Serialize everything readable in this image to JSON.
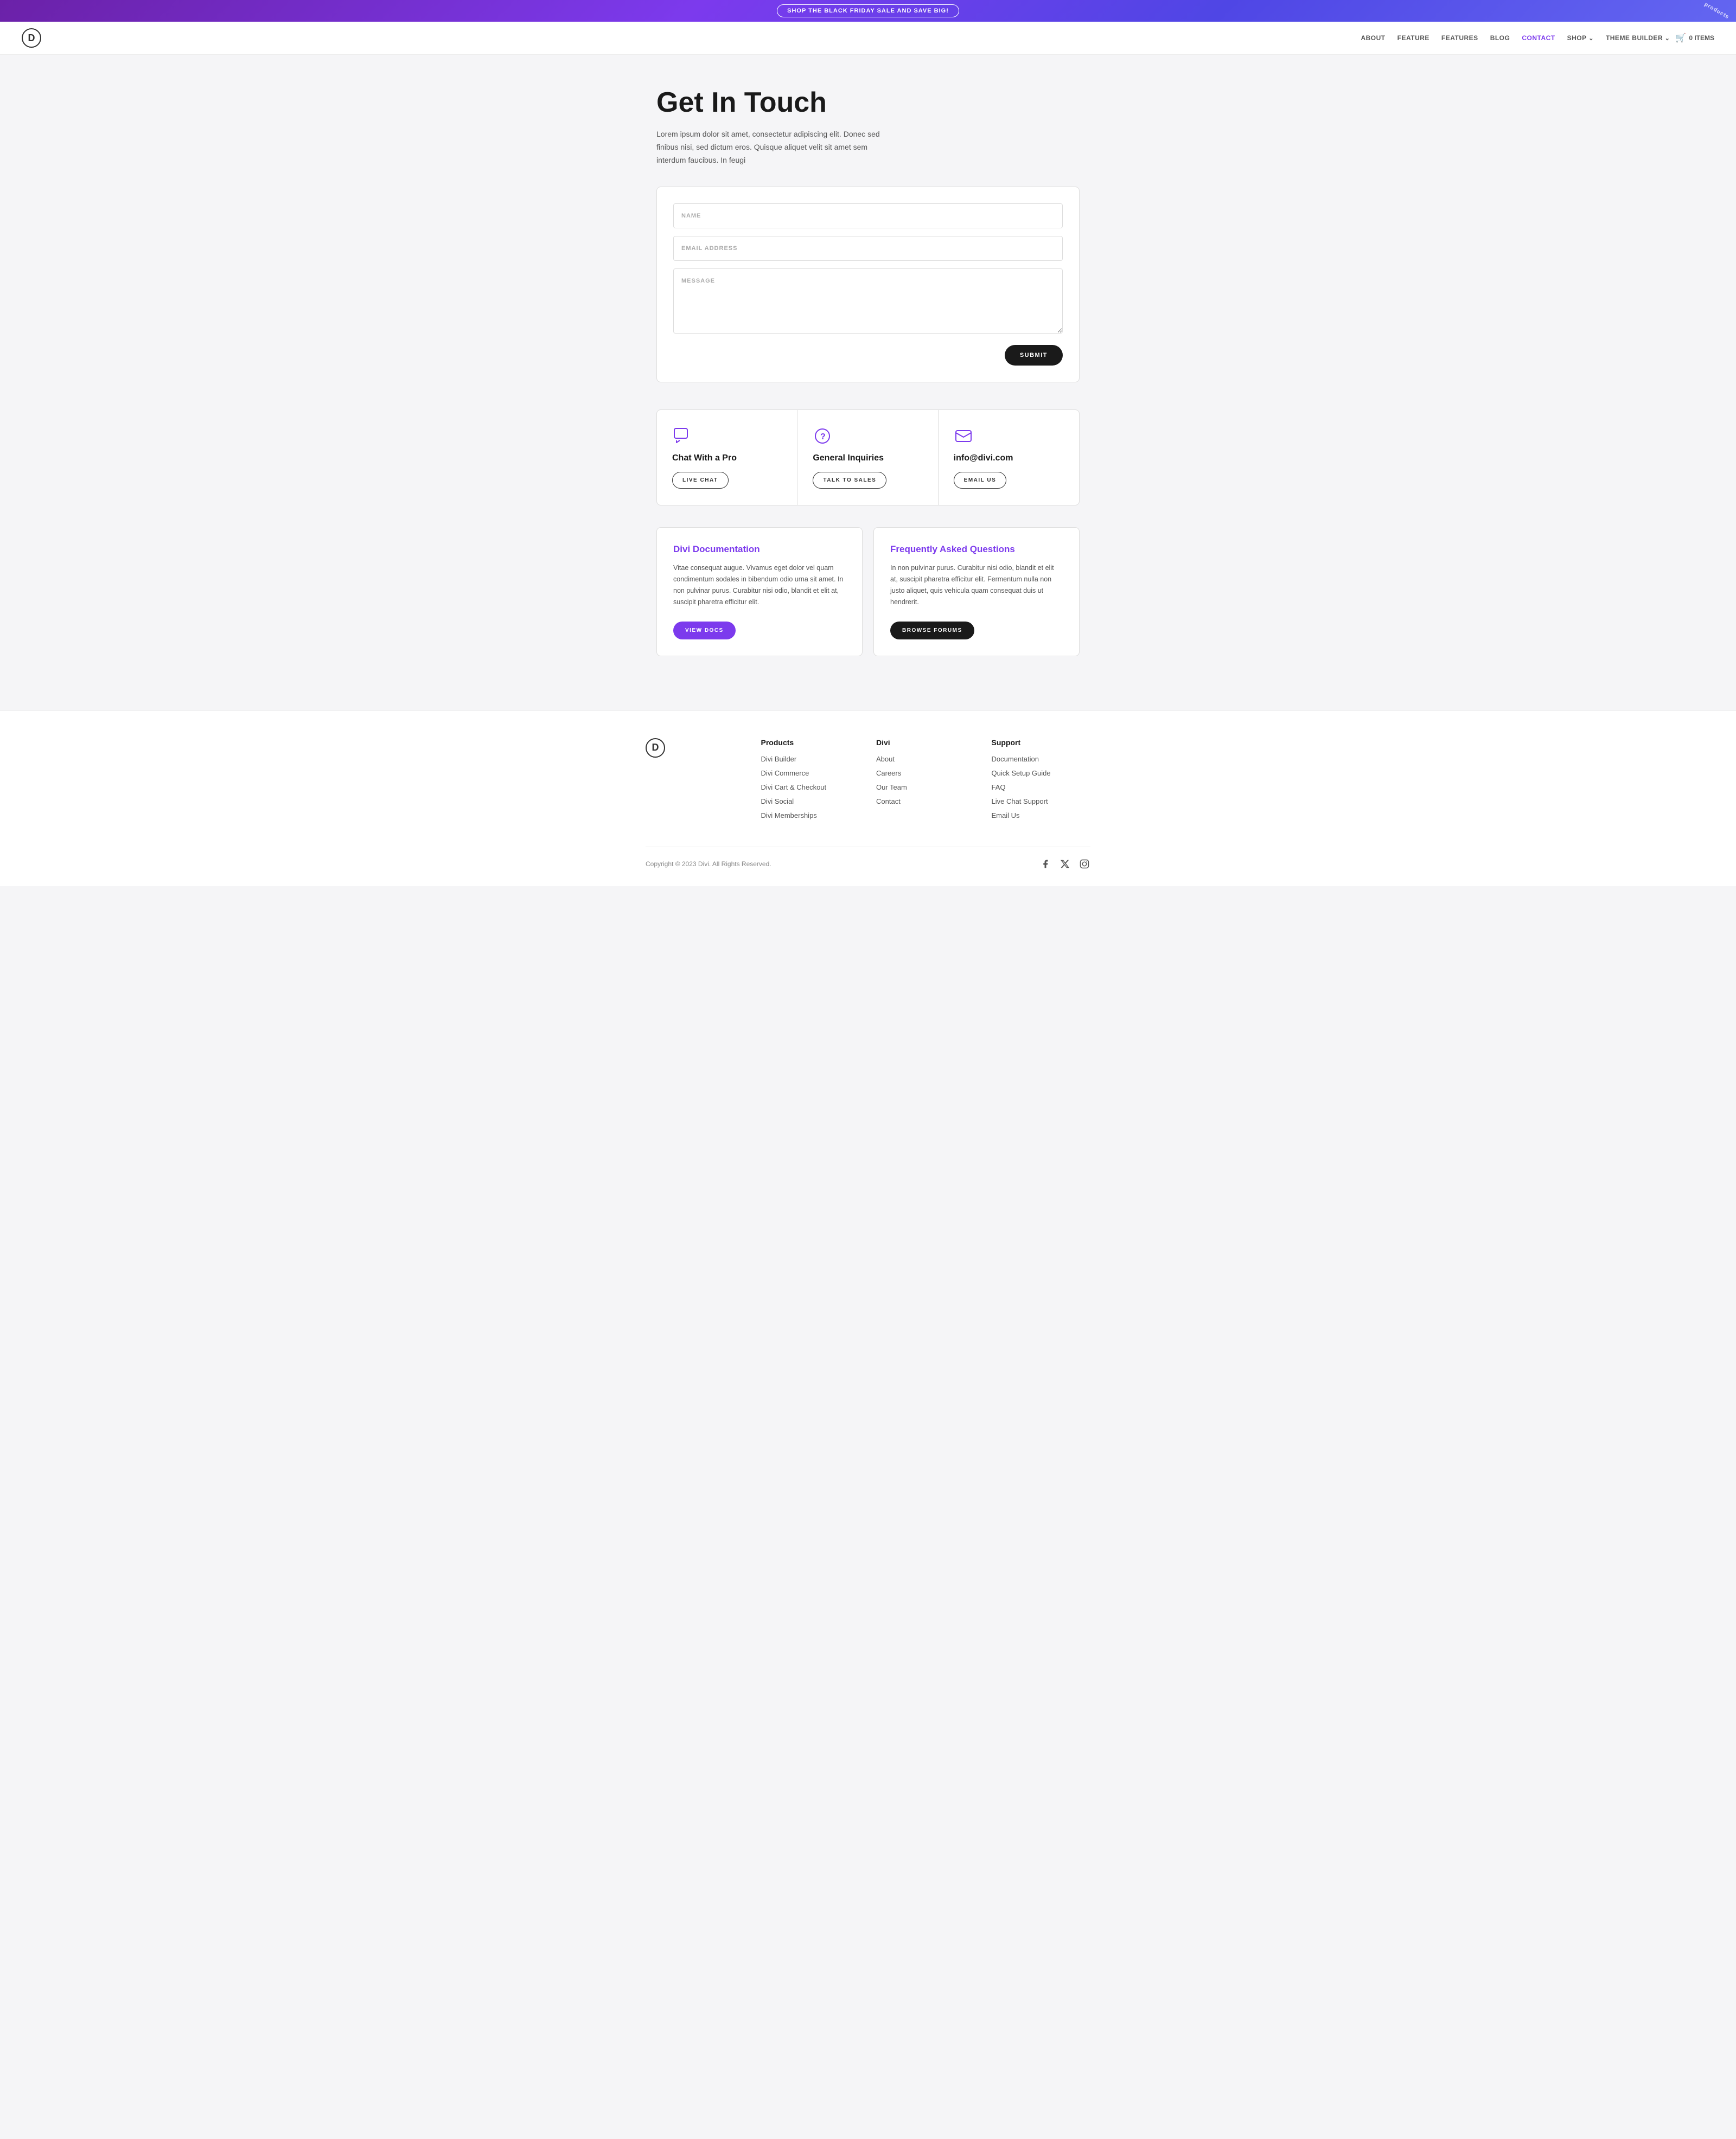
{
  "banner": {
    "cta_label": "SHOP THE BLACK FRIDAY SALE AND SAVE BIG!",
    "products_label": "products"
  },
  "nav": {
    "logo_letter": "D",
    "links": [
      {
        "label": "ABOUT",
        "active": false
      },
      {
        "label": "FEATURE",
        "active": false
      },
      {
        "label": "FEATURES",
        "active": false
      },
      {
        "label": "BLOG",
        "active": false
      },
      {
        "label": "CONTACT",
        "active": true
      },
      {
        "label": "SHOP",
        "active": false,
        "has_arrow": true
      },
      {
        "label": "THEME BUILDER",
        "active": false,
        "has_arrow": true
      }
    ],
    "cart_label": "0 ITEMS"
  },
  "hero": {
    "title": "Get In Touch",
    "description": "Lorem ipsum dolor sit amet, consectetur adipiscing elit. Donec sed finibus nisi, sed dictum eros. Quisque aliquet velit sit amet sem interdum faucibus. In feugi"
  },
  "form": {
    "name_placeholder": "NAME",
    "email_placeholder": "EMAIL ADDRESS",
    "message_placeholder": "MESSAGE",
    "submit_label": "SUBMIT"
  },
  "contact_cards": [
    {
      "icon": "chat",
      "title": "Chat With a Pro",
      "button_label": "LIVE CHAT"
    },
    {
      "icon": "question",
      "title": "General Inquiries",
      "button_label": "TALK TO SALES"
    },
    {
      "icon": "email",
      "title": "info@divi.com",
      "button_label": "EMAIL US"
    }
  ],
  "info_cards": [
    {
      "title": "Divi Documentation",
      "description": "Vitae consequat augue. Vivamus eget dolor vel quam condimentum sodales in bibendum odio urna sit amet. In non pulvinar purus. Curabitur nisi odio, blandit et elit at, suscipit pharetra efficitur elit.",
      "button_label": "VIEW DOCS",
      "button_style": "purple"
    },
    {
      "title": "Frequently Asked Questions",
      "description": "In non pulvinar purus. Curabitur nisi odio, blandit et elit at, suscipit pharetra efficitur elit. Fermentum nulla non justo aliquet, quis vehicula quam consequat duis ut hendrerit.",
      "button_label": "BROWSE FORUMS",
      "button_style": "dark"
    }
  ],
  "footer": {
    "logo_letter": "D",
    "columns": [
      {
        "title": "Products",
        "links": [
          "Divi Builder",
          "Divi Commerce",
          "Divi Cart & Checkout",
          "Divi Social",
          "Divi Memberships"
        ]
      },
      {
        "title": "Divi",
        "links": [
          "About",
          "Careers",
          "Our Team",
          "Contact"
        ]
      },
      {
        "title": "Support",
        "links": [
          "Documentation",
          "Quick Setup Guide",
          "FAQ",
          "Live Chat Support",
          "Email Us"
        ]
      }
    ],
    "copyright": "Copyright © 2023 Divi. All Rights Reserved.",
    "social_icons": [
      "facebook",
      "x-twitter",
      "instagram"
    ]
  }
}
